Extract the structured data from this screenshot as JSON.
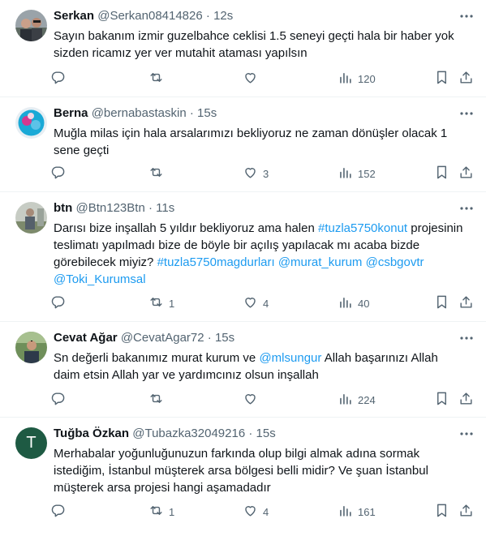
{
  "tweets": [
    {
      "name": "Serkan",
      "handle": "@Serkan08414826",
      "time": "12s",
      "avatar": "photo",
      "segments": [
        {
          "text": "Sayın bakanım izmir guzelbahce ceklisi 1.5 seneyi geçti hala bir haber yok sizden ricamız yer ver mutahit ataması yapılsın",
          "link": false
        }
      ],
      "counts": {
        "reply": "",
        "retweet": "",
        "like": "",
        "views": "120"
      }
    },
    {
      "name": "Berna",
      "handle": "@bernabastaskin",
      "time": "15s",
      "avatar": "photo",
      "segments": [
        {
          "text": "Muğla milas için hala arsalarımızı bekliyoruz ne zaman dönüşler olacak 1 sene geçti",
          "link": false
        }
      ],
      "counts": {
        "reply": "",
        "retweet": "",
        "like": "3",
        "views": "152"
      }
    },
    {
      "name": "btn",
      "handle": "@Btn123Btn",
      "time": "11s",
      "avatar": "photo",
      "segments": [
        {
          "text": "Darısı bize inşallah 5 yıldır bekliyoruz ama halen ",
          "link": false
        },
        {
          "text": "#tuzla5750konut",
          "link": true
        },
        {
          "text": " projesinin teslimatı yapılmadı bize de böyle bir açılış yapılacak mı acaba bizde görebilecek miyiz? ",
          "link": false
        },
        {
          "text": "#tuzla5750magdurları",
          "link": true
        },
        {
          "text": " ",
          "link": false
        },
        {
          "text": "@murat_kurum",
          "link": true
        },
        {
          "text": " ",
          "link": false
        },
        {
          "text": "@csbgovtr",
          "link": true
        },
        {
          "text": " ",
          "link": false
        },
        {
          "text": "@Toki_Kurumsal",
          "link": true
        }
      ],
      "counts": {
        "reply": "",
        "retweet": "1",
        "like": "4",
        "views": "40"
      }
    },
    {
      "name": "Cevat Ağar",
      "handle": "@CevatAgar72",
      "time": "15s",
      "avatar": "photo",
      "segments": [
        {
          "text": "Sn değerli bakanımız murat kurum ve ",
          "link": false
        },
        {
          "text": "@mlsungur",
          "link": true
        },
        {
          "text": " Allah başarınızı Allah daim etsin Allah yar ve yardımcınız olsun inşallah",
          "link": false
        }
      ],
      "counts": {
        "reply": "",
        "retweet": "",
        "like": "",
        "views": "224"
      }
    },
    {
      "name": "Tuğba Özkan",
      "handle": "@Tubazka32049216",
      "time": "15s",
      "avatar": "letter",
      "avatar_letter": "T",
      "segments": [
        {
          "text": "Merhabalar yoğunluğunuzun farkında olup bilgi almak adına sormak istediğim, İstanbul müşterek arsa bölgesi belli midir? Ve şuan İstanbul müşterek arsa projesi hangi aşamadadır",
          "link": false
        }
      ],
      "counts": {
        "reply": "",
        "retweet": "1",
        "like": "4",
        "views": "161"
      }
    }
  ],
  "icons": {
    "more": "more-dots-icon",
    "reply": "reply-icon",
    "retweet": "retweet-icon",
    "like": "heart-icon",
    "views": "views-chart-icon",
    "bookmark": "bookmark-icon",
    "share": "share-icon"
  },
  "colors": {
    "text": "#0f1419",
    "secondary": "#536471",
    "link": "#1d9bf0",
    "divider": "#eff3f4",
    "letter_avatar_bg": "#1e5a43"
  }
}
